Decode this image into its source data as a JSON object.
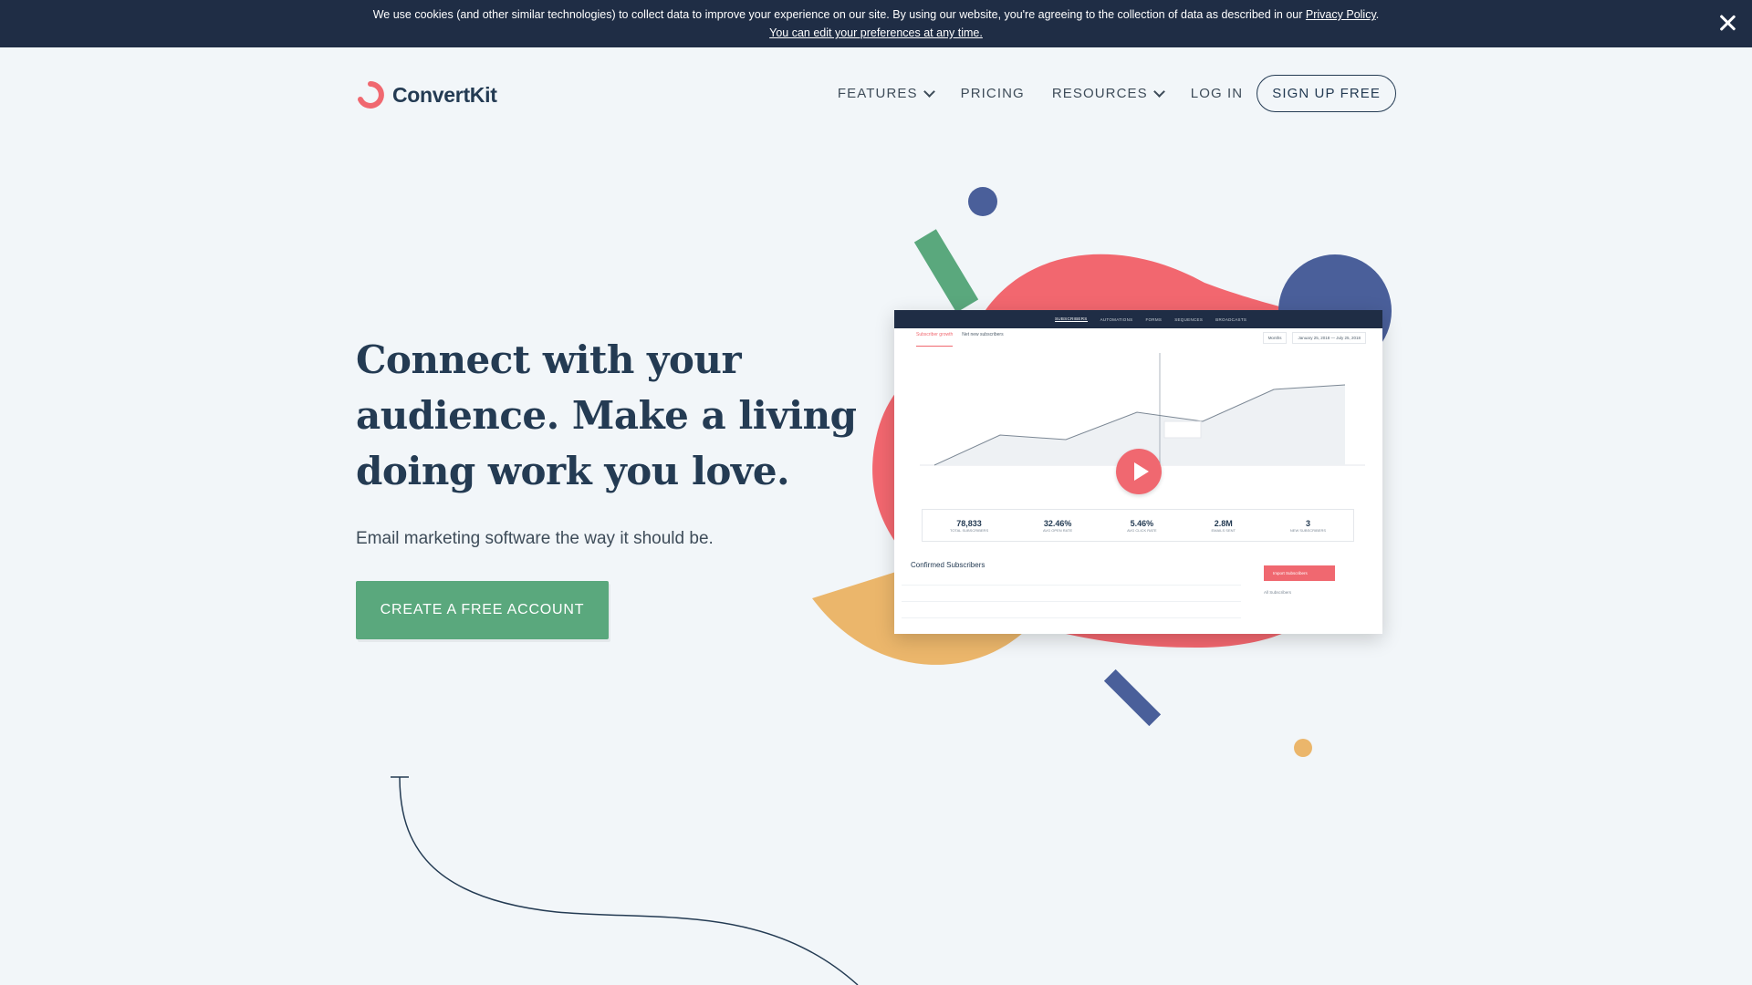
{
  "cookie_banner": {
    "text": "We use cookies (and other similar technologies) to collect data to improve your experience on our site. By using our website, you're agreeing to the collection of data as described in our",
    "privacy_link": "Privacy Policy",
    "period": ".",
    "preferences_link": "You can edit your preferences at any time."
  },
  "brand": {
    "name": "ConvertKit",
    "accent": "#f06870"
  },
  "nav": {
    "features": "FEATURES",
    "pricing": "PRICING",
    "resources": "RESOURCES",
    "login": "LOG IN",
    "signup": "SIGN UP FREE"
  },
  "hero": {
    "headline": "Connect with your audience. Make a living doing work you love.",
    "subheadline": "Email marketing software the way it should be.",
    "cta": "CREATE A FREE ACCOUNT",
    "cta_color": "#5aa87d"
  },
  "screenshot": {
    "topnav": [
      "SUBSCRIBERS",
      "AUTOMATIONS",
      "FORMS",
      "SEQUENCES",
      "BROADCASTS"
    ],
    "tabs": [
      "Subscriber growth",
      "Net new subscribers"
    ],
    "period": "Months",
    "date_range": "January 25, 2018 — July 25, 2018",
    "stats": [
      {
        "value": "78,833",
        "label": "TOTAL SUBSCRIBERS"
      },
      {
        "value": "32.46%",
        "label": "AVG OPEN RATE"
      },
      {
        "value": "5.46%",
        "label": "AVG CLICK RATE"
      },
      {
        "value": "2.8M",
        "label": "EMAILS SENT"
      },
      {
        "value": "3",
        "label": "NEW SUBSCRIBERS"
      }
    ],
    "list_title": "Confirmed Subscribers",
    "import_button": "Import Subscribers",
    "side_label": "All Subscribers"
  }
}
